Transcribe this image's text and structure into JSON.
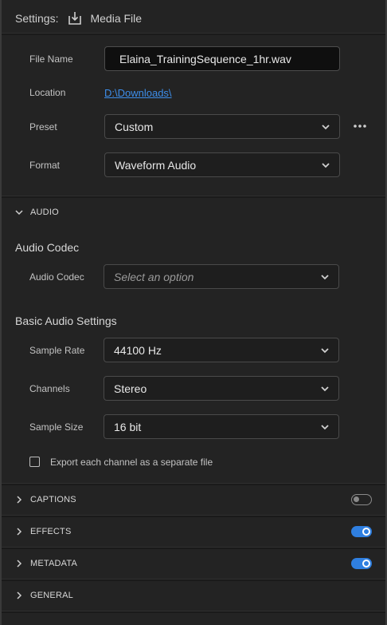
{
  "header": {
    "settings_label": "Settings:",
    "icon": "download-icon",
    "title": "Media File"
  },
  "file": {
    "name_label": "File Name",
    "name_value": "Elaina_TrainingSequence_1hr.wav",
    "location_label": "Location",
    "location_value": "D:\\Downloads\\",
    "preset_label": "Preset",
    "preset_value": "Custom",
    "format_label": "Format",
    "format_value": "Waveform Audio"
  },
  "audio": {
    "section_label": "AUDIO",
    "codec_heading": "Audio Codec",
    "codec_label": "Audio Codec",
    "codec_placeholder": "Select an option",
    "basic_heading": "Basic Audio Settings",
    "sample_rate_label": "Sample Rate",
    "sample_rate_value": "44100 Hz",
    "channels_label": "Channels",
    "channels_value": "Stereo",
    "sample_size_label": "Sample Size",
    "sample_size_value": "16 bit",
    "export_each_label": "Export each channel as a separate file",
    "export_each_checked": false
  },
  "sections": {
    "captions": {
      "label": "CAPTIONS",
      "enabled": false
    },
    "effects": {
      "label": "EFFECTS",
      "enabled": true
    },
    "metadata": {
      "label": "METADATA",
      "enabled": true
    },
    "general": {
      "label": "GENERAL"
    }
  },
  "colors": {
    "accent": "#2f7fe0",
    "link": "#3d8eea",
    "background": "#232323"
  }
}
